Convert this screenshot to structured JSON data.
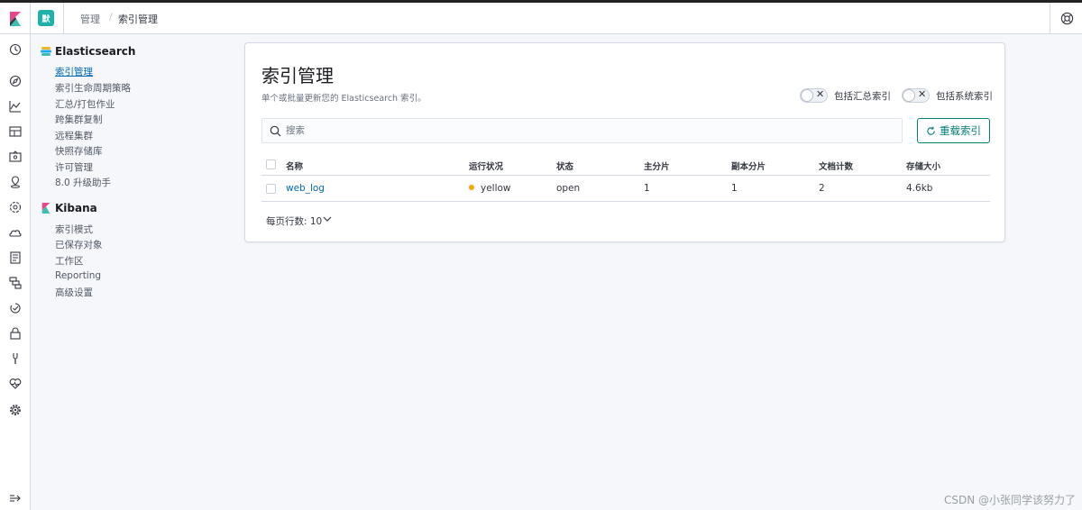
{
  "header": {
    "space_avatar": "默",
    "breadcrumbs": [
      "管理",
      "索引管理"
    ],
    "breadcrumb_separator": "/"
  },
  "nav_icons": [
    "clock-icon",
    "compass-icon",
    "visualize-icon",
    "dashboard-icon",
    "canvas-icon",
    "maps-icon",
    "ml-icon",
    "infra-icon",
    "logs-icon",
    "apm-icon",
    "uptime-icon",
    "siem-icon",
    "devtools-icon",
    "monitoring-icon",
    "management-icon"
  ],
  "sidebar": {
    "elasticsearch_title": "Elasticsearch",
    "elasticsearch_items": [
      "索引管理",
      "索引生命周期策略",
      "汇总/打包作业",
      "跨集群复制",
      "远程集群",
      "快照存储库",
      "许可管理",
      "8.0 升级助手"
    ],
    "kibana_title": "Kibana",
    "kibana_items": [
      "索引模式",
      "已保存对象",
      "工作区",
      "Reporting",
      "高级设置"
    ]
  },
  "main": {
    "title": "索引管理",
    "description": "单个或批量更新您的 Elasticsearch 索引。",
    "toggle_rollup_label": "包括汇总索引",
    "toggle_system_label": "包括系统索引",
    "search_placeholder": "搜索",
    "reload_button": "重载索引",
    "table": {
      "headers": [
        "名称",
        "运行状况",
        "状态",
        "主分片",
        "副本分片",
        "文档计数",
        "存储大小"
      ],
      "rows": [
        {
          "name": "web_log",
          "health": "yellow",
          "status": "open",
          "primary": "1",
          "replicas": "1",
          "docs": "2",
          "size": "4.6kb"
        }
      ]
    },
    "rows_per_page": "每页行数: 10"
  },
  "colors": {
    "accent": "#006bb4",
    "success": "#017d73",
    "health_yellow": "#f5a700"
  },
  "watermark": "CSDN @小张同学该努力了"
}
